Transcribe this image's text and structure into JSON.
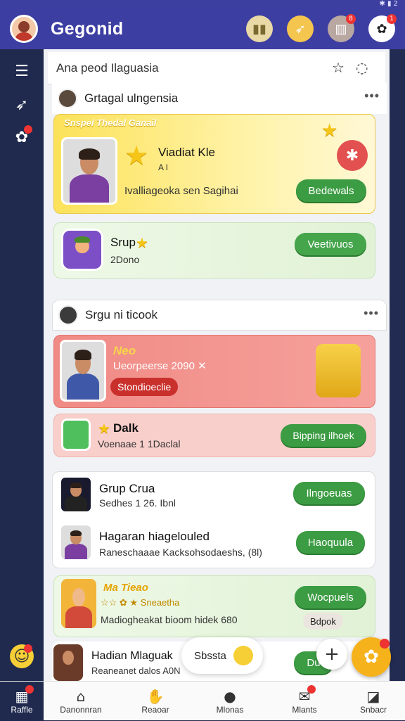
{
  "status": {
    "right": "✱ ▮ 2"
  },
  "app": {
    "title": "Gegonid"
  },
  "topbar": {
    "icons": [
      {
        "name": "trophy-icon",
        "glyph": "▮▮",
        "bg": "#e8d9a6",
        "color": "#7a6a2f"
      },
      {
        "name": "rocket-icon",
        "glyph": "➶",
        "bg": "#f4c64f",
        "color": "#fff"
      },
      {
        "name": "shop-icon",
        "glyph": "▥",
        "bg": "#b9a7a2",
        "color": "#fff",
        "badge": "8"
      },
      {
        "name": "game-icon",
        "glyph": "✿",
        "bg": "#ffffff",
        "color": "#222",
        "badge": "1"
      }
    ]
  },
  "search": {
    "text": "Ana peod Ilaguasia"
  },
  "sidebar": {
    "items": [
      {
        "name": "menu-icon",
        "glyph": "☰"
      },
      {
        "name": "rocket-icon",
        "glyph": "➶"
      },
      {
        "name": "friends-icon",
        "glyph": "✿",
        "badge": true
      },
      {
        "name": "smile-icon",
        "glyph": "☺",
        "badge": true
      }
    ]
  },
  "groups": {
    "g1_title": "Grtagal ulngensia",
    "g2_title": "Srgu ni ticook"
  },
  "feed": {
    "featured": {
      "ribbon": "Snspel Thedal Ganail",
      "name": "Viadiat Kle",
      "tag": "A I",
      "desc": "Ivalliageoka sen Sagihai",
      "button": "Bedewals"
    },
    "item2": {
      "name": "Srup",
      "sub": "2Dono",
      "button": "Veetivuos"
    },
    "item3": {
      "name": "Neo",
      "sub": "Ueorpeerse 2090 ✕",
      "chip": "Stondioeclie"
    },
    "item4": {
      "name": "Dalk",
      "sub": "Voenaae 1 1Daclal",
      "button": "Bipping ilhoek"
    },
    "item5": {
      "name": "Grup Crua",
      "sub": "Sedhes 1 26. Ibnl",
      "button": "Ilngoeuas"
    },
    "item6": {
      "name": "Hagaran hiagelouled",
      "sub": "Raneschaaae Kacksohsodaeshs, (8l)",
      "button": "Haoquula"
    },
    "item7": {
      "name": "Ma Tieao",
      "sub": "☆☆ ✿ ★ Sneaetha",
      "sub2": "Madiogheakat bioom hidek 680",
      "button": "Wocpuels",
      "sub3": "Bdpok"
    },
    "item8": {
      "name": "Hadian Mlaguak",
      "sub": "Reaneanet dalos A0N",
      "button": "Du"
    }
  },
  "toast": {
    "text": "Sbssta"
  },
  "bottomnav": {
    "items": [
      {
        "name": "nav-raffle",
        "label": "Raffle",
        "glyph": "▦",
        "badge": true
      },
      {
        "name": "nav-home",
        "label": "Danonnran",
        "glyph": "⌂"
      },
      {
        "name": "nav-reactions",
        "label": "Reaoar",
        "glyph": "✋"
      },
      {
        "name": "nav-modes",
        "label": "Mlonas",
        "glyph": "●"
      },
      {
        "name": "nav-mailbox",
        "label": "Mlants",
        "glyph": "✉",
        "badge": true
      },
      {
        "name": "nav-settings",
        "label": "Snbacr",
        "glyph": "◪"
      }
    ]
  },
  "colors": {
    "topbar": "#3d3ea2",
    "sidebar": "#1f2a4e",
    "accent_green": "#3c9c43",
    "featured_yellow": "#fce25a",
    "alert_red": "#f08a85"
  }
}
